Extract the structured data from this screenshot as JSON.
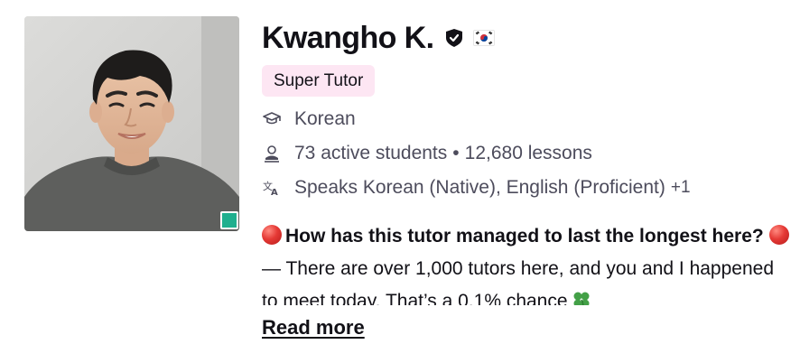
{
  "profile": {
    "name": "Kwangho K.",
    "badge": "Super Tutor",
    "subject": "Korean",
    "active_students": "73 active students",
    "lessons": "12,680 lessons",
    "speaks": "Speaks Korean (Native), English (Proficient)",
    "speaks_more": "+1",
    "online": true
  },
  "description": {
    "headline": "How has this tutor managed to last the longest here?",
    "body": "— There are over 1,000 tutors here, and you and I happened to meet today. That’s a 0.1% chance",
    "read_more": "Read more"
  },
  "icons": {
    "verified": "verified-shield-icon",
    "flag": "south-korea-flag-icon",
    "subject": "graduation-cap-icon",
    "students": "person-icon",
    "languages": "translate-icon",
    "red_dot": "red-circle-emoji",
    "clover": "four-leaf-clover-emoji"
  },
  "colors": {
    "badge_bg": "#fde6f3",
    "online": "#1faf8e",
    "text_primary": "#121117",
    "text_secondary": "#4d4c5c"
  }
}
